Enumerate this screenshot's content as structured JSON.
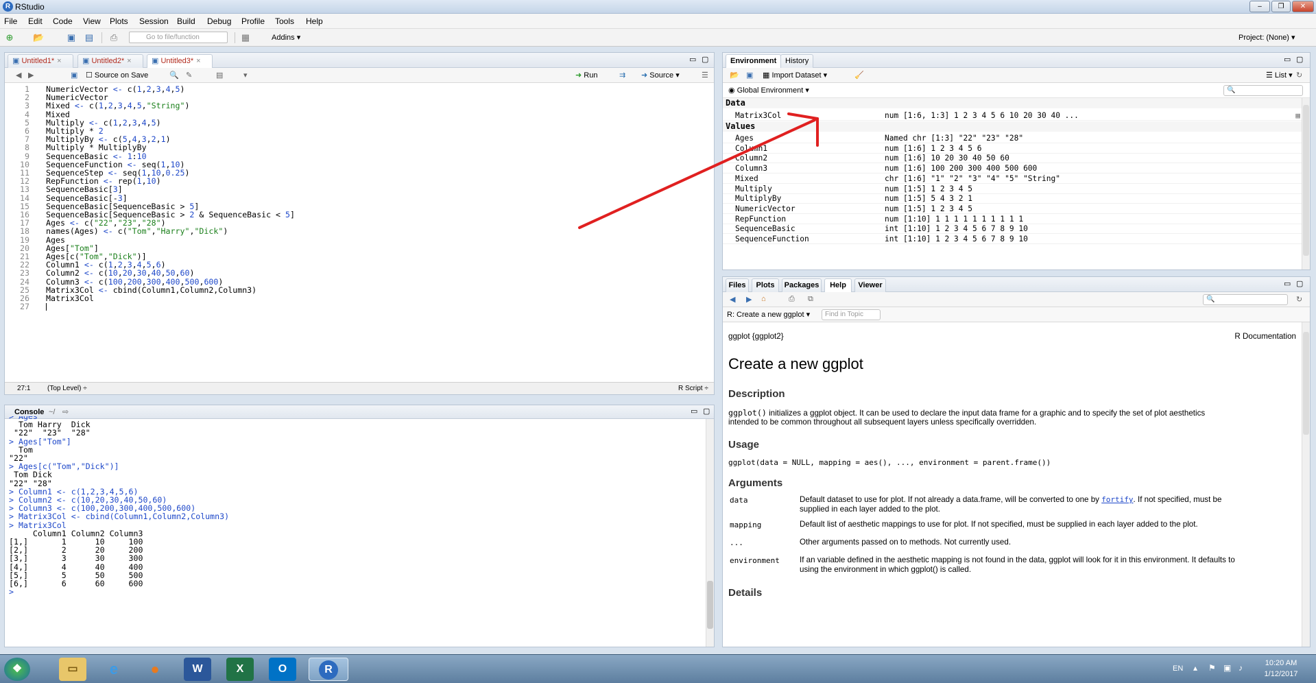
{
  "window": {
    "title": "RStudio",
    "min": "–",
    "restore": "❐",
    "close": "✕"
  },
  "menu": [
    "File",
    "Edit",
    "Code",
    "View",
    "Plots",
    "Session",
    "Build",
    "Debug",
    "Profile",
    "Tools",
    "Help"
  ],
  "toolbar": {
    "goto_placeholder": "Go to file/function",
    "addins": "Addins",
    "project": "Project: (None)"
  },
  "editor": {
    "tabs": [
      "Untitled1*",
      "Untitled2*",
      "Untitled3*"
    ],
    "source_on_save": "Source on Save",
    "run": "Run",
    "source": "Source",
    "lines": [
      "NumericVector <- c(1,2,3,4,5)",
      "NumericVector",
      "Mixed <- c(1,2,3,4,5,\"String\")",
      "Mixed",
      "Multiply <- c(1,2,3,4,5)",
      "Multiply * 2",
      "MultiplyBy <- c(5,4,3,2,1)",
      "Multiply * MultiplyBy",
      "SequenceBasic <- 1:10",
      "SequenceFunction <- seq(1,10)",
      "SequenceStep <- seq(1,10,0.25)",
      "RepFunction <- rep(1,10)",
      "SequenceBasic[3]",
      "SequenceBasic[-3]",
      "SequenceBasic[SequenceBasic > 5]",
      "SequenceBasic[SequenceBasic > 2 & SequenceBasic < 5]",
      "Ages <- c(\"22\",\"23\",\"28\")",
      "names(Ages) <- c(\"Tom\",\"Harry\",\"Dick\")",
      "Ages",
      "Ages[\"Tom\"]",
      "Ages[c(\"Tom\",\"Dick\")]",
      "Column1 <- c(1,2,3,4,5,6)",
      "Column2 <- c(10,20,30,40,50,60)",
      "Column3 <- c(100,200,300,400,500,600)",
      "Matrix3Col <- cbind(Column1,Column2,Column3)",
      "Matrix3Col",
      ""
    ],
    "line_numbers": [
      "1",
      "2",
      "3",
      "4",
      "5",
      "6",
      "7",
      "8",
      "9",
      "10",
      "11",
      "12",
      "13",
      "14",
      "15",
      "16",
      "17",
      "18",
      "19",
      "20",
      "21",
      "22",
      "23",
      "24",
      "25",
      "26",
      "27"
    ],
    "status_pos": "27:1",
    "status_scope": "(Top Level) ÷",
    "status_type": "R Script ÷"
  },
  "console": {
    "title": "Console",
    "path": "~/",
    "lines": [
      {
        "t": "> Ages",
        "c": "blue"
      },
      {
        "t": "  Tom Harry  Dick",
        "c": ""
      },
      {
        "t": " \"22\"  \"23\"  \"28\"",
        "c": ""
      },
      {
        "t": "> Ages[\"Tom\"]",
        "c": "blue"
      },
      {
        "t": "  Tom",
        "c": ""
      },
      {
        "t": "\"22\"",
        "c": ""
      },
      {
        "t": "> Ages[c(\"Tom\",\"Dick\")]",
        "c": "blue"
      },
      {
        "t": " Tom Dick",
        "c": ""
      },
      {
        "t": "\"22\" \"28\"",
        "c": ""
      },
      {
        "t": "> Column1 <- c(1,2,3,4,5,6)",
        "c": "blue"
      },
      {
        "t": "> Column2 <- c(10,20,30,40,50,60)",
        "c": "blue"
      },
      {
        "t": "> Column3 <- c(100,200,300,400,500,600)",
        "c": "blue"
      },
      {
        "t": "> Matrix3Col <- cbind(Column1,Column2,Column3)",
        "c": "blue"
      },
      {
        "t": "> Matrix3Col",
        "c": "blue"
      },
      {
        "t": "     Column1 Column2 Column3",
        "c": ""
      },
      {
        "t": "[1,]       1      10     100",
        "c": ""
      },
      {
        "t": "[2,]       2      20     200",
        "c": ""
      },
      {
        "t": "[3,]       3      30     300",
        "c": ""
      },
      {
        "t": "[4,]       4      40     400",
        "c": ""
      },
      {
        "t": "[5,]       5      50     500",
        "c": ""
      },
      {
        "t": "[6,]       6      60     600",
        "c": ""
      },
      {
        "t": "> ",
        "c": "blue"
      }
    ]
  },
  "environment": {
    "tabs": [
      "Environment",
      "History"
    ],
    "import": "Import Dataset",
    "list": "List",
    "scope": "Global Environment",
    "data_header": "Data",
    "values_header": "Values",
    "data": [
      {
        "name": "Matrix3Col",
        "value": "num [1:6, 1:3] 1 2 3 4 5 6 10 20 30 40 ..."
      }
    ],
    "values": [
      {
        "name": "Ages",
        "value": "Named chr [1:3] \"22\" \"23\" \"28\""
      },
      {
        "name": "Column1",
        "value": "num [1:6] 1 2 3 4 5 6"
      },
      {
        "name": "Column2",
        "value": "num [1:6] 10 20 30 40 50 60"
      },
      {
        "name": "Column3",
        "value": "num [1:6] 100 200 300 400 500 600"
      },
      {
        "name": "Mixed",
        "value": "chr [1:6] \"1\" \"2\" \"3\" \"4\" \"5\" \"String\""
      },
      {
        "name": "Multiply",
        "value": "num [1:5] 1 2 3 4 5"
      },
      {
        "name": "MultiplyBy",
        "value": "num [1:5] 5 4 3 2 1"
      },
      {
        "name": "NumericVector",
        "value": "num [1:5] 1 2 3 4 5"
      },
      {
        "name": "RepFunction",
        "value": "num [1:10] 1 1 1 1 1 1 1 1 1 1"
      },
      {
        "name": "SequenceBasic",
        "value": "int [1:10] 1 2 3 4 5 6 7 8 9 10"
      },
      {
        "name": "SequenceFunction",
        "value": "int [1:10] 1 2 3 4 5 6 7 8 9 10"
      }
    ]
  },
  "help": {
    "tabs": [
      "Files",
      "Plots",
      "Packages",
      "Help",
      "Viewer"
    ],
    "topic": "R: Create a new ggplot",
    "find_placeholder": "Find in Topic",
    "pkg": "ggplot {ggplot2}",
    "rdoc": "R Documentation",
    "title": "Create a new ggplot",
    "description_h": "Description",
    "description_code": "ggplot()",
    "description_line1": " initializes a ggplot object. It can be used to declare the input data frame for a graphic and to specify the set of plot aesthetics",
    "description_line2": "intended to be common throughout all subsequent layers unless specifically overridden.",
    "usage_h": "Usage",
    "usage": "ggplot(data = NULL, mapping = aes(), ..., environment = parent.frame())",
    "arguments_h": "Arguments",
    "args": [
      {
        "name": "data",
        "desc1": "Default dataset to use for plot. If not already a data.frame, will be converted to one by ",
        "link": "fortify",
        "desc1b": ". If not specified, must be",
        "desc2": "supplied in each layer added to the plot."
      },
      {
        "name": "mapping",
        "desc1": "Default list of aesthetic mappings to use for plot. If not specified, must be supplied in each layer added to the plot.",
        "link": "",
        "desc1b": "",
        "desc2": ""
      },
      {
        "name": "...",
        "desc1": "Other arguments passed on to methods. Not currently used.",
        "link": "",
        "desc1b": "",
        "desc2": ""
      },
      {
        "name": "environment",
        "desc1": "If an variable defined in the aesthetic mapping is not found in the data, ggplot will look for it in this environment. It defaults to",
        "link": "",
        "desc1b": "",
        "desc2": "using the environment in which ggplot() is called."
      }
    ],
    "details_h": "Details"
  },
  "taskbar": {
    "lang": "EN",
    "time": "10:20 AM",
    "date": "1/12/2017",
    "apps": [
      "start",
      "explorer",
      "ie",
      "firefox",
      "word",
      "excel",
      "outlook",
      "rstudio"
    ]
  },
  "annotation_color": "#e02020"
}
